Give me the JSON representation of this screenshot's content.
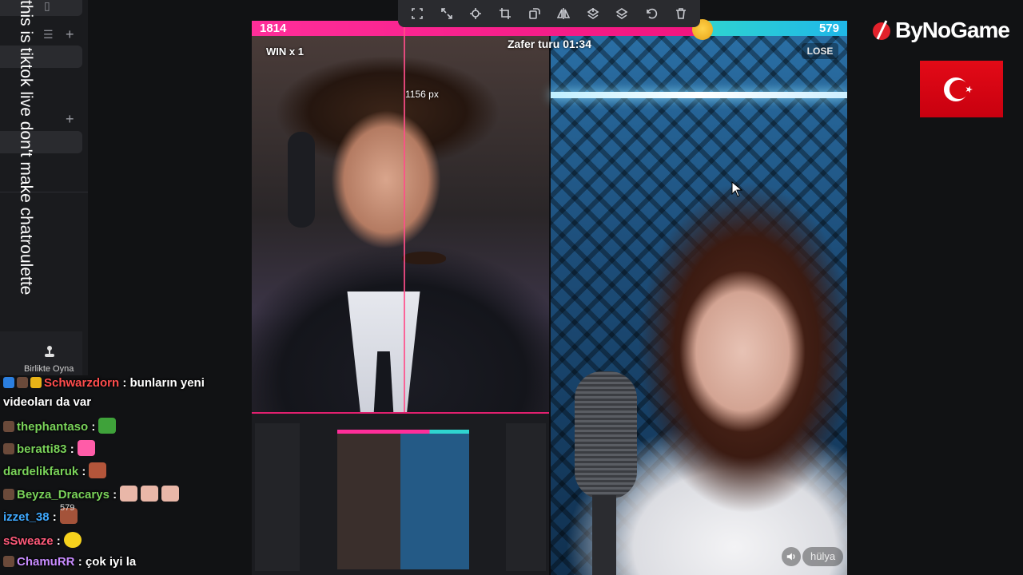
{
  "overlay_text": "this is tiktok live don't make chatroulette",
  "sidebar": {
    "play_together_label": "Birlikte Oyna"
  },
  "chat": {
    "messages": [
      {
        "user": "Schwarzdorn",
        "text": ": bunların yeni",
        "continuation": "videoları da var",
        "user_color": "#ff4d4d"
      },
      {
        "user": "thephantaso",
        "text": ":",
        "user_color": "#7ad35a"
      },
      {
        "user": "beratti83",
        "text": ":",
        "user_color": "#7ad35a"
      },
      {
        "user": "dardelikfaruk",
        "text": ":",
        "user_color": "#7ad35a"
      },
      {
        "user": "Beyza_Dracarys",
        "text": ":",
        "user_color": "#7ad35a"
      },
      {
        "user": "izzet_38",
        "text": ":",
        "user_color": "#3fa9ff"
      },
      {
        "user": "sSweaze",
        "text": ":",
        "user_color": "#ff5a7a"
      },
      {
        "user": "ChamuRR",
        "text": ": çok iyi la",
        "user_color": "#c88cff"
      }
    ],
    "floating_count": "579"
  },
  "battle": {
    "score_left": "1814",
    "score_right": "579",
    "left_color": "#f0157f",
    "right_color": "#2fd4d0",
    "left_share": 0.758,
    "timer": "Zafer turu 01:34",
    "win_label": "WIN x 1",
    "lose_label": "LOSE",
    "opponent_name": "hülya"
  },
  "guide": {
    "measure_label": "1156 px"
  },
  "toolbar": {
    "buttons": [
      "fit-icon",
      "expand-icon",
      "center-icon",
      "crop-icon",
      "rotate-icon",
      "mirror-icon",
      "layer-up-icon",
      "layer-down-icon",
      "undo-icon",
      "delete-icon"
    ]
  },
  "brand": {
    "name": "ByNoGame",
    "flag": "Türkiye"
  }
}
